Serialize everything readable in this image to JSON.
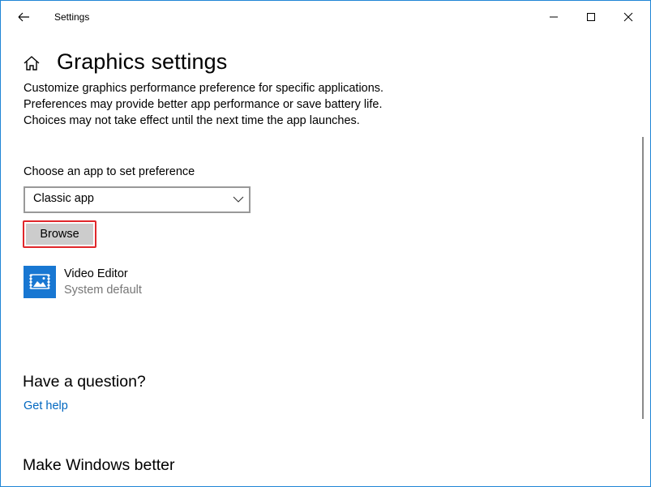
{
  "window": {
    "title": "Settings",
    "border_color": "#1f86d6",
    "controls": {
      "back": "back-arrow-icon",
      "minimize": "minimize-icon",
      "maximize": "maximize-icon",
      "close": "close-icon"
    }
  },
  "page": {
    "title": "Graphics settings",
    "home_icon": "home-icon",
    "description": "Customize graphics performance preference for specific applications. Preferences may provide better app performance or save battery life. Choices may not take effect until the next time the app launches."
  },
  "app_chooser": {
    "label": "Choose an app to set preference",
    "selected": "Classic app",
    "browse_label": "Browse",
    "highlight_color": "#e0272b"
  },
  "apps": [
    {
      "name": "Video Editor",
      "preference": "System default",
      "icon": "video-editor-icon",
      "tile_color": "#1877d2"
    }
  ],
  "help": {
    "heading": "Have a question?",
    "link": "Get help",
    "link_color": "#0067c0"
  },
  "feedback": {
    "heading": "Make Windows better"
  }
}
